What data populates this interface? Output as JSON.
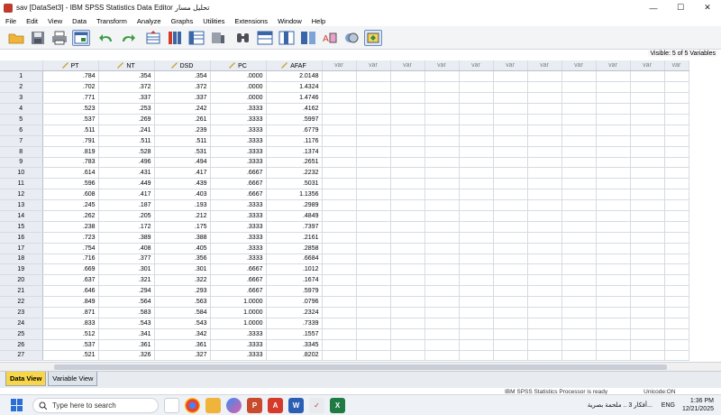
{
  "window": {
    "title": "sav [DataSet3] - IBM SPSS Statistics Data Editor تحليل مسار",
    "controls": [
      "—",
      "☐",
      "✕"
    ]
  },
  "menu": [
    "File",
    "Edit",
    "View",
    "Data",
    "Transform",
    "Analyze",
    "Graphs",
    "Utilities",
    "Extensions",
    "Window",
    "Help"
  ],
  "visible_label": "Visible: 5 of 5 Variables",
  "grid": {
    "columns": [
      "PT",
      "NT",
      "DSD",
      "PC",
      "AFAF"
    ],
    "empty_header": "var",
    "empty_column_count": 11,
    "rows": [
      [
        "1",
        ".784",
        ".354",
        ".354",
        ".0000",
        "2.0148"
      ],
      [
        "2",
        ".702",
        ".372",
        ".372",
        ".0000",
        "1.4324"
      ],
      [
        "3",
        ".771",
        ".337",
        ".337",
        ".0000",
        "1.4746"
      ],
      [
        "4",
        ".523",
        ".253",
        ".242",
        ".3333",
        ".4162"
      ],
      [
        "5",
        ".537",
        ".269",
        ".261",
        ".3333",
        ".5997"
      ],
      [
        "6",
        ".511",
        ".241",
        ".239",
        ".3333",
        ".6779"
      ],
      [
        "7",
        ".791",
        ".511",
        ".511",
        ".3333",
        ".1176"
      ],
      [
        "8",
        ".819",
        ".528",
        ".531",
        ".3333",
        ".1374"
      ],
      [
        "9",
        ".783",
        ".496",
        ".494",
        ".3333",
        ".2651"
      ],
      [
        "10",
        ".614",
        ".431",
        ".417",
        ".6667",
        ".2232"
      ],
      [
        "11",
        ".596",
        ".449",
        ".439",
        ".6667",
        ".5031"
      ],
      [
        "12",
        ".608",
        ".417",
        ".403",
        ".6667",
        "1.1356"
      ],
      [
        "13",
        ".245",
        ".187",
        ".193",
        ".3333",
        ".2989"
      ],
      [
        "14",
        ".262",
        ".205",
        ".212",
        ".3333",
        ".4849"
      ],
      [
        "15",
        ".238",
        ".172",
        ".175",
        ".3333",
        ".7397"
      ],
      [
        "16",
        ".723",
        ".389",
        ".388",
        ".3333",
        ".2161"
      ],
      [
        "17",
        ".754",
        ".408",
        ".405",
        ".3333",
        ".2858"
      ],
      [
        "18",
        ".716",
        ".377",
        ".356",
        ".3333",
        ".6684"
      ],
      [
        "19",
        ".669",
        ".301",
        ".301",
        ".6667",
        ".1012"
      ],
      [
        "20",
        ".637",
        ".321",
        ".322",
        ".6667",
        ".1674"
      ],
      [
        "21",
        ".646",
        ".294",
        ".293",
        ".6667",
        ".5979"
      ],
      [
        "22",
        ".849",
        ".564",
        ".563",
        "1.0000",
        ".0796"
      ],
      [
        "23",
        ".871",
        ".583",
        ".584",
        "1.0000",
        ".2324"
      ],
      [
        "24",
        ".833",
        ".543",
        ".543",
        "1.0000",
        ".7339"
      ],
      [
        "25",
        ".512",
        ".341",
        ".342",
        ".3333",
        ".1557"
      ],
      [
        "26",
        ".537",
        ".361",
        ".361",
        ".3333",
        ".3345"
      ],
      [
        "27",
        ".521",
        ".326",
        ".327",
        ".3333",
        ".8202"
      ]
    ]
  },
  "tabs": {
    "data_view": "Data View",
    "variable_view": "Variable View"
  },
  "status": {
    "processor": "IBM SPSS Statistics Processor is ready",
    "encoding": "Unicode:ON"
  },
  "taskbar": {
    "search_placeholder": "Type here to search",
    "notification": "أفكار 3 .. ملحمة بصرية...",
    "time": "1:36 PM",
    "date": "12/21/2025",
    "lang": "ENG"
  },
  "colors": {
    "active_tab": "#f7d64a",
    "header_bg": "#e9edf3",
    "windows_blue": "#2b6fd6"
  }
}
